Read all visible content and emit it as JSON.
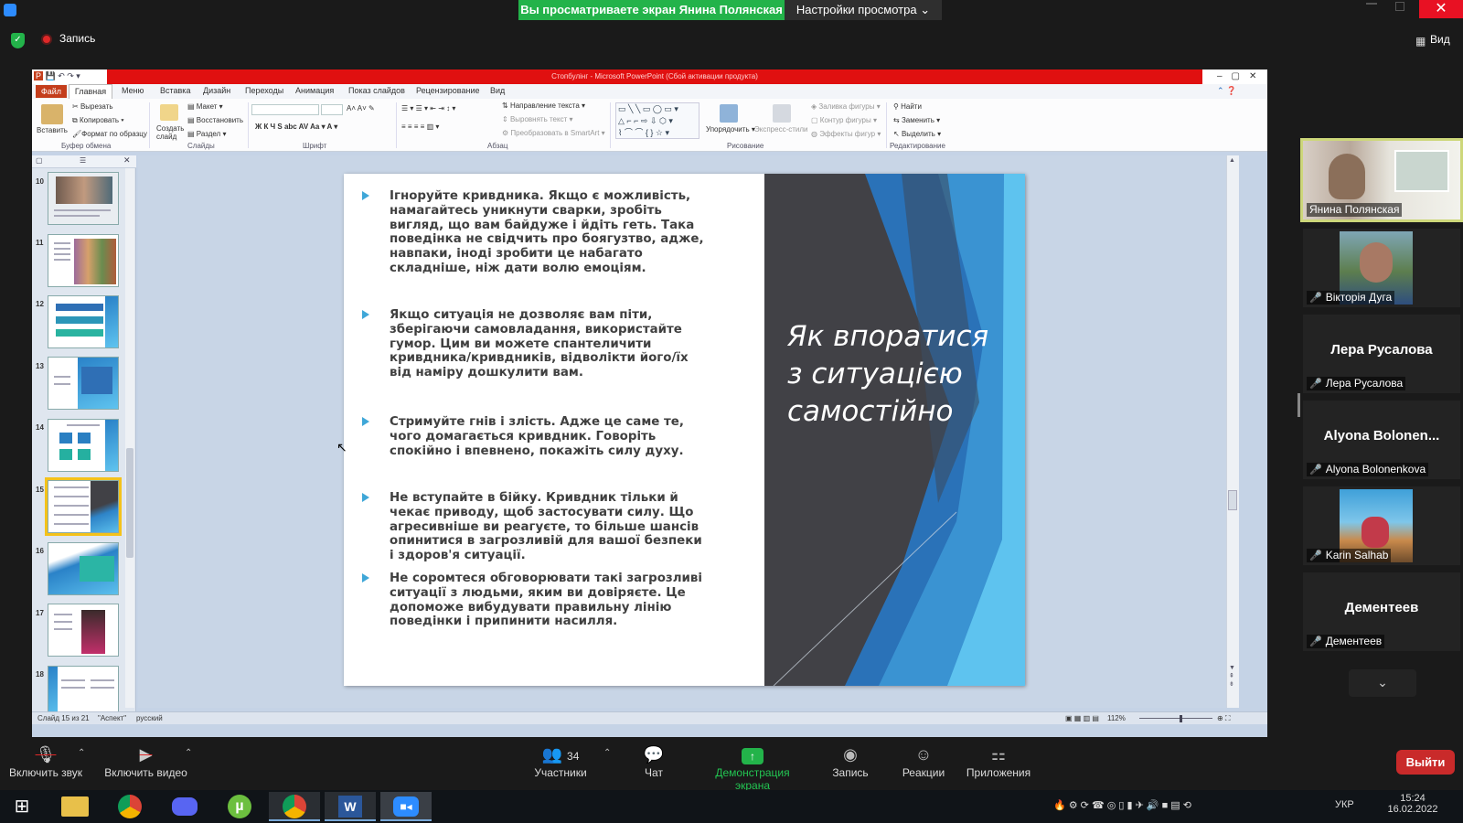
{
  "zoom": {
    "share_banner": "Вы просматриваете экран Янина Полянская",
    "view_options": "Настройки просмотра",
    "record_label": "Запись",
    "view_label": "Вид"
  },
  "ppt": {
    "window_title": "Стопбулінг - Microsoft PowerPoint (Сбой активации продукта)",
    "tabs": [
      "Файл",
      "Главная",
      "Меню",
      "Вставка",
      "Дизайн",
      "Переходы",
      "Анимация",
      "Показ слайдов",
      "Рецензирование",
      "Вид"
    ],
    "ribbon": {
      "paste": "Вставить",
      "cut": "Вырезать",
      "copy": "Копировать",
      "format_painter": "Формат по образцу",
      "new_slide": "Создать слайд",
      "layout": "Макет",
      "reset": "Восстановить",
      "section": "Раздел",
      "text_direction": "Направление текста",
      "align_text": "Выровнять текст",
      "smartart": "Преобразовать в SmartArt",
      "arrange": "Упорядочить",
      "quick_styles": "Экспресс-стили",
      "shape_fill": "Заливка фигуры",
      "shape_outline": "Контур фигуры",
      "shape_effects": "Эффекты фигур",
      "find": "Найти",
      "replace": "Заменить",
      "select": "Выделить",
      "groups": {
        "clipboard": "Буфер обмена",
        "slides": "Слайды",
        "font": "Шрифт",
        "paragraph": "Абзац",
        "drawing": "Рисование",
        "editing": "Редактирование"
      }
    },
    "thumbnails": [
      "10",
      "11",
      "12",
      "13",
      "14",
      "15",
      "16",
      "17",
      "18"
    ],
    "slide": {
      "title": "Як впоратися з ситуацією самостійно",
      "bullets": [
        "Ігноруйте кривдника. Якщо є можливість, намагайтесь уникнути сварки, зробіть вигляд, що вам байдуже і йдіть геть. Така поведінка не свідчить про боягузтво, адже, навпаки, іноді зробити це набагато складніше, ніж дати волю емоціям.",
        "Якщо ситуація не дозволяє вам піти, зберігаючи самовладання, використайте гумор. Цим ви можете спантеличити кривдника/кривдників, відволікти його/їх від наміру дошкулити вам.",
        "Стримуйте гнів і злість. Адже це саме те, чого домагається кривдник. Говоріть спокійно і впевнено, покажіть силу духу.",
        "Не вступайте в бійку. Кривдник тільки й чекає приводу, щоб застосувати силу. Що агресивніше ви реагуєте, то більше шансів опинитися в загрозливій для вашої безпеки і здоров'я ситуації.",
        "Не соромтеся обговорювати такі загрозливі ситуації з людьми, яким ви довіряєте. Це допоможе вибудувати правильну лінію поведінки і припинити насилля."
      ]
    },
    "status": {
      "slide_pos": "Слайд 15 из 21",
      "theme": "\"Аспект\"",
      "language": "русский",
      "zoom": "112%"
    }
  },
  "participants": [
    {
      "name": "Янина Полянская",
      "big": "",
      "video": true
    },
    {
      "name": "Вікторія Дуга",
      "big": "",
      "video": true
    },
    {
      "name": "Лера Русалова",
      "big": "Лера Русалова",
      "video": false
    },
    {
      "name": "Alyona Bolonenkova",
      "big": "Alyona Bolonen...",
      "video": false
    },
    {
      "name": "Karin Salhab",
      "big": "",
      "video": true
    },
    {
      "name": "Дементеев",
      "big": "Дементеев",
      "video": false
    }
  ],
  "toolbar": {
    "unmute": "Включить звук",
    "start_video": "Включить видео",
    "participants": "Участники",
    "participants_count": "34",
    "chat": "Чат",
    "share_screen": "Демонстрация экрана",
    "record": "Запись",
    "reactions": "Реакции",
    "apps": "Приложения",
    "leave": "Выйти"
  },
  "taskbar": {
    "lang": "УКР",
    "time": "15:24",
    "date": "16.02.2022"
  },
  "colors": {
    "share_green": "#23b34a",
    "leave_red": "#c92a2a",
    "ppt_title_red": "#e01010",
    "slide_accent": "#3fa7d8"
  }
}
